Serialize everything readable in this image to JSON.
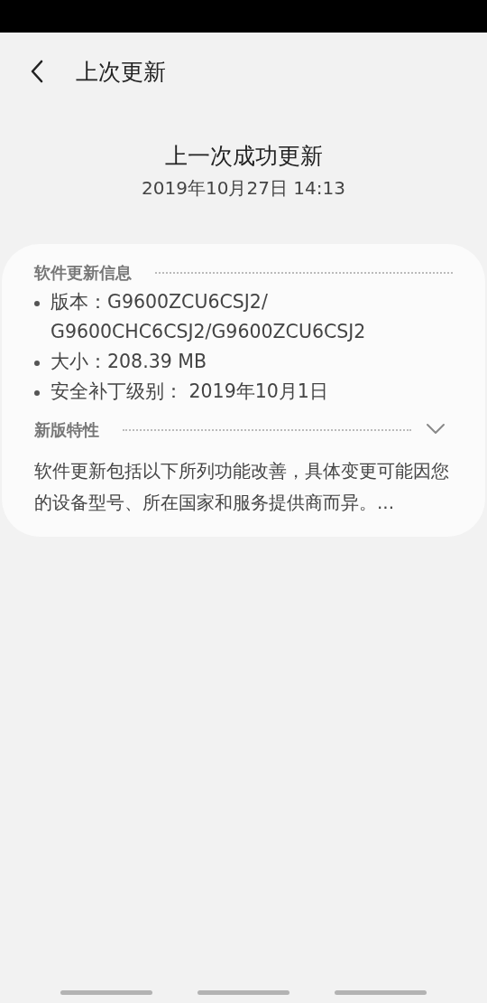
{
  "header": {
    "title": "上次更新"
  },
  "summary": {
    "heading": "上一次成功更新",
    "date": "2019年10月27日 14:13"
  },
  "card": {
    "info_section": {
      "title": "软件更新信息",
      "items": [
        {
          "label": "版本：",
          "value": "G9600ZCU6CSJ2/ G9600CHC6CSJ2/G9600ZCU6CSJ2"
        },
        {
          "label": "大小：",
          "value": "208.39 MB"
        },
        {
          "label": "安全补丁级别：",
          "value": " 2019年10月1日"
        }
      ]
    },
    "features_section": {
      "title": "新版特性",
      "expanded": false,
      "text": "软件更新包括以下所列功能改善，具体变更可能因您的设备型号、所在国家和服务提供商而异。..."
    }
  }
}
